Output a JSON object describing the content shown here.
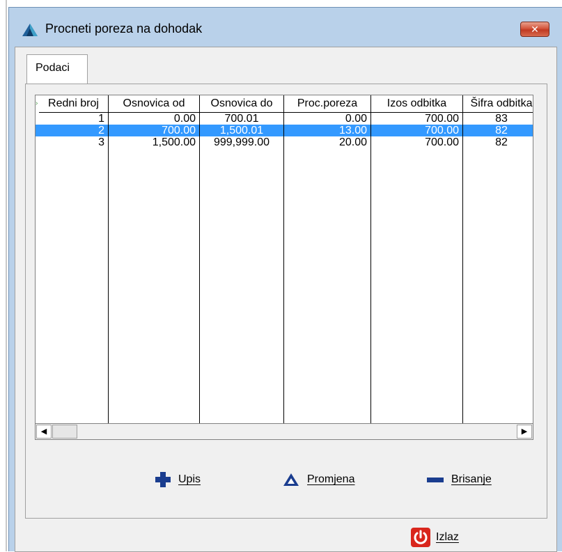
{
  "window": {
    "title": "Procneti poreza na dohodak",
    "close_glyph": "✕"
  },
  "tabs": [
    {
      "label": "Podaci"
    }
  ],
  "grid": {
    "indicator": "›",
    "columns": [
      "Redni broj",
      "Osnovica od",
      "Osnovica do",
      "Proc.poreza",
      "Izos odbitka",
      "Šifra odbitka"
    ],
    "rows": [
      [
        "1",
        "0.00",
        "700.01",
        "0.00",
        "700.00",
        "83"
      ],
      [
        "2",
        "700.00",
        "1,500.01",
        "13.00",
        "700.00",
        "82"
      ],
      [
        "3",
        "1,500.00",
        "999,999.00",
        "20.00",
        "700.00",
        "82"
      ]
    ],
    "selected_row": 1
  },
  "scrollbar": {
    "left_arrow": "◀",
    "right_arrow": "▶"
  },
  "actions": {
    "add_label": "Upis",
    "edit_label": "Promjena",
    "delete_label": "Brisanje",
    "exit_label": "Izlaz"
  },
  "colors": {
    "selection": "#3399ff",
    "window_frame": "#b9d1ea",
    "add_icon": "#1a3d8f",
    "exit_icon": "#d9261c"
  }
}
